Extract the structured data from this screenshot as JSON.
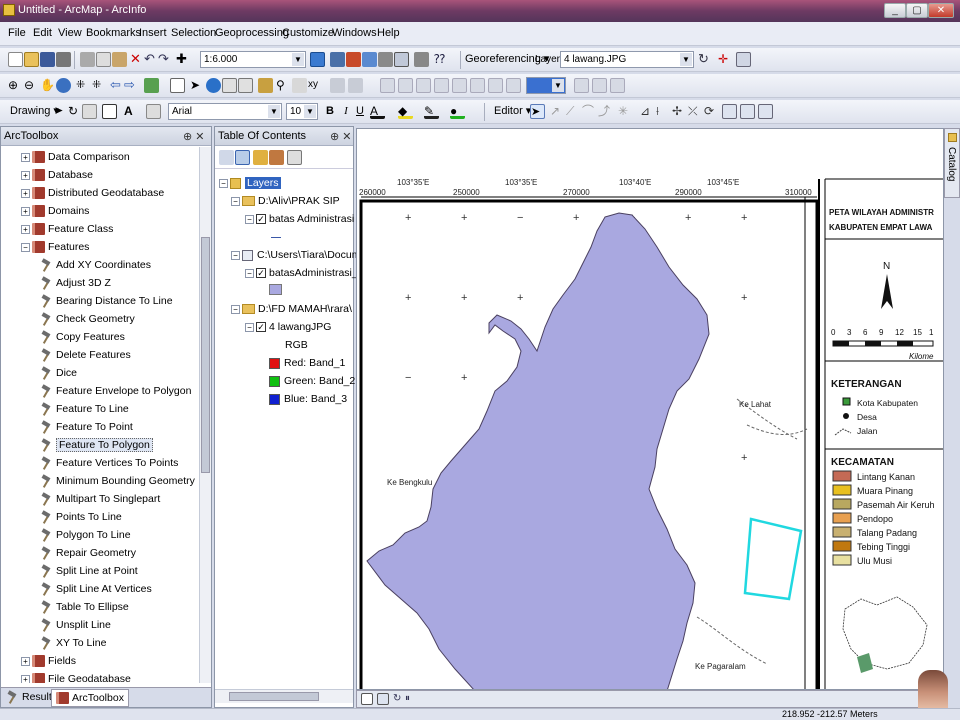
{
  "window": {
    "title": "Untitled - ArcMap - ArcInfo",
    "min": "_",
    "max": "▢",
    "close": "✕"
  },
  "menu": [
    "File",
    "Edit",
    "View",
    "Bookmarks",
    "Insert",
    "Selection",
    "Geoprocessing",
    "Customize",
    "Windows",
    "Help"
  ],
  "toolbar1": {
    "scale": "1:6.000",
    "georef_label": "Georeferencing ▾",
    "layer_label": "Layer:",
    "layer_value": "4 lawang.JPG"
  },
  "toolbar3": {
    "drawing_label": "Drawing ▾",
    "font_name": "Arial",
    "font_size": "10",
    "bold": "B",
    "italic": "I",
    "underline": "U",
    "editor_label": "Editor ▾"
  },
  "toolbox": {
    "title": "ArcToolbox",
    "pin": "⊕ ✕",
    "items": [
      {
        "label": "Data Comparison",
        "kind": "toolset",
        "expander": "+"
      },
      {
        "label": "Database",
        "kind": "toolset",
        "expander": "+"
      },
      {
        "label": "Distributed Geodatabase",
        "kind": "toolset",
        "expander": "+"
      },
      {
        "label": "Domains",
        "kind": "toolset",
        "expander": "+"
      },
      {
        "label": "Feature Class",
        "kind": "toolset",
        "expander": "+"
      },
      {
        "label": "Features",
        "kind": "toolset",
        "expander": "−"
      },
      {
        "label": "Add XY Coordinates",
        "kind": "tool"
      },
      {
        "label": "Adjust 3D Z",
        "kind": "tool"
      },
      {
        "label": "Bearing Distance To Line",
        "kind": "tool"
      },
      {
        "label": "Check Geometry",
        "kind": "tool"
      },
      {
        "label": "Copy Features",
        "kind": "tool"
      },
      {
        "label": "Delete Features",
        "kind": "tool"
      },
      {
        "label": "Dice",
        "kind": "tool"
      },
      {
        "label": "Feature Envelope to Polygon",
        "kind": "tool"
      },
      {
        "label": "Feature To Line",
        "kind": "tool"
      },
      {
        "label": "Feature To Point",
        "kind": "tool"
      },
      {
        "label": "Feature To Polygon",
        "kind": "tool",
        "selected": true
      },
      {
        "label": "Feature Vertices To Points",
        "kind": "tool"
      },
      {
        "label": "Minimum Bounding Geometry",
        "kind": "tool"
      },
      {
        "label": "Multipart To Singlepart",
        "kind": "tool"
      },
      {
        "label": "Points To Line",
        "kind": "tool"
      },
      {
        "label": "Polygon To Line",
        "kind": "tool"
      },
      {
        "label": "Repair Geometry",
        "kind": "tool"
      },
      {
        "label": "Split Line at Point",
        "kind": "tool"
      },
      {
        "label": "Split Line At Vertices",
        "kind": "tool"
      },
      {
        "label": "Table To Ellipse",
        "kind": "tool"
      },
      {
        "label": "Unsplit Line",
        "kind": "tool"
      },
      {
        "label": "XY To Line",
        "kind": "tool"
      },
      {
        "label": "Fields",
        "kind": "toolset",
        "expander": "+"
      },
      {
        "label": "File Geodatabase",
        "kind": "toolset",
        "expander": "+"
      }
    ],
    "tabs": [
      "Results",
      "ArcToolbox"
    ]
  },
  "toc": {
    "title": "Table Of Contents",
    "pin": "⊕ ✕",
    "root": "Layers",
    "groups": [
      {
        "path": "D:\\Aliv\\PRAK SIP",
        "layer": "batas Administrasi"
      },
      {
        "path": "C:\\Users\\Tiara\\Documen",
        "layer": "batasAdministrasi_Fea"
      },
      {
        "path": "D:\\FD MAMAH\\rara\\",
        "layer": "4 lawangJPG",
        "rgb": "RGB",
        "bands": [
          {
            "label": "Red:  Band_1",
            "color": "#e01010"
          },
          {
            "label": "Green: Band_2",
            "color": "#10c010"
          },
          {
            "label": "Blue:  Band_3",
            "color": "#1020d0"
          }
        ]
      }
    ]
  },
  "map": {
    "fill_color": "#a9a8e0",
    "grid_top_labels": [
      "260000",
      "250000",
      "270000",
      "280000",
      "290000",
      "300000",
      "310000"
    ],
    "grid_top_sublabels": [
      "103°35'E",
      "103°35'E",
      "103°40'E",
      "103°45'E"
    ],
    "place_labels": [
      "Ke Lahat",
      "Ke Bengkulu",
      "Ke Pagaralam"
    ],
    "map_title_1": "PETA WILAYAH ADMINISTR",
    "map_title_2": "KABUPATEN EMPAT LAWA",
    "north": "N",
    "scale_ticks": [
      "0",
      "3",
      "6",
      "9",
      "12",
      "15",
      "1"
    ],
    "scale_unit": "Kilome",
    "keterangan": "KETERANGAN",
    "legend_items": [
      "Kota Kabupaten",
      "Desa",
      "Jalan"
    ],
    "kecamatan": "KECAMATAN",
    "kecamatan_items": [
      {
        "label": "Lintang Kanan",
        "color": "#c46a55"
      },
      {
        "label": "Muara Pinang",
        "color": "#e8c020"
      },
      {
        "label": "Pasemah Air Keruh",
        "color": "#b8a860"
      },
      {
        "label": "Pendopo",
        "color": "#e8a050"
      },
      {
        "label": "Talang Padang",
        "color": "#c8b070"
      },
      {
        "label": "Tebing Tinggi",
        "color": "#c07810"
      },
      {
        "label": "Ulu Musi",
        "color": "#e8e0a0"
      }
    ],
    "catalog_tab": "Catalog"
  },
  "status": {
    "coords": "218.952  -212.57 Meters"
  }
}
